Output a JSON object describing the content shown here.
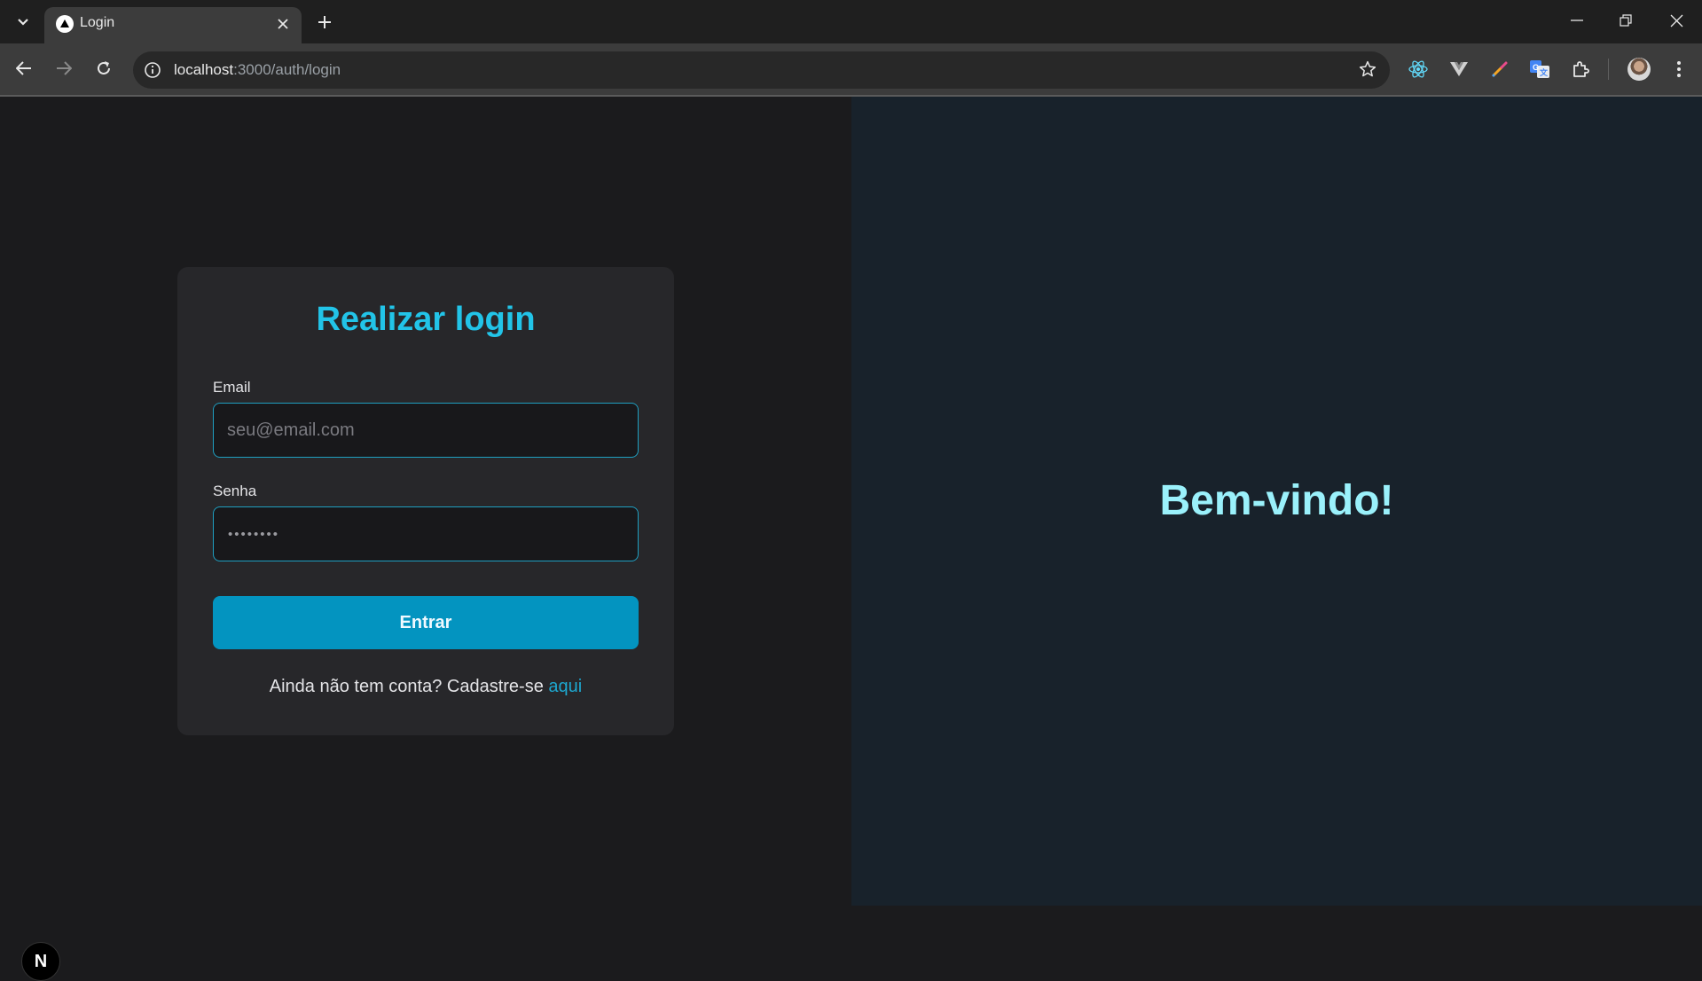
{
  "browser": {
    "tab_title": "Login",
    "url_host": "localhost",
    "url_rest": ":3000/auth/login"
  },
  "login": {
    "title": "Realizar login",
    "email_label": "Email",
    "email_placeholder": "seu@email.com",
    "password_label": "Senha",
    "password_mask": "••••••••",
    "submit_label": "Entrar",
    "signup_text": "Ainda não tem conta? Cadastre-se ",
    "signup_link": "aqui"
  },
  "welcome": {
    "heading": "Bem-vindo!"
  },
  "devtools": {
    "badge": "N"
  },
  "colors": {
    "accent": "#22c4e8",
    "button": "#0394c0",
    "welcome": "#9af1fb",
    "left_bg": "#1b1b1d",
    "right_bg": "#18222b",
    "card_bg": "#27272a"
  },
  "icons": [
    "tab-search-icon",
    "close-icon",
    "plus-icon",
    "minimize-icon",
    "restore-icon",
    "back-icon",
    "forward-icon",
    "reload-icon",
    "info-icon",
    "star-icon",
    "react-devtools-icon",
    "vue-devtools-icon",
    "color-picker-icon",
    "translate-icon",
    "extensions-icon",
    "more-vert-icon"
  ]
}
